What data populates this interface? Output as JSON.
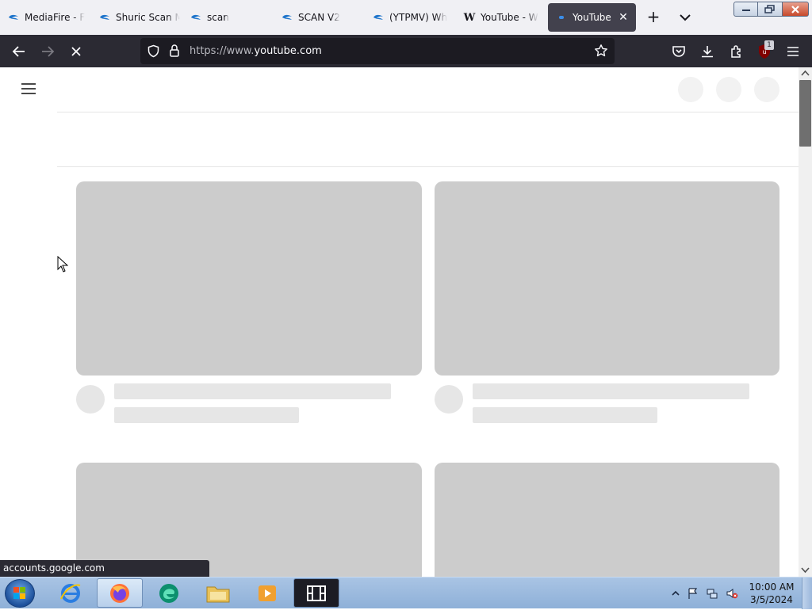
{
  "browser": {
    "tabs": [
      {
        "title": "MediaFire - F",
        "favicon": "mediafire-icon"
      },
      {
        "title": "Shuric Scan M",
        "favicon": "mediafire-icon"
      },
      {
        "title": "scan",
        "favicon": "mediafire-icon"
      },
      {
        "title": "SCAN V2",
        "favicon": "mediafire-icon"
      },
      {
        "title": "(YTPMV) Wh",
        "favicon": "mediafire-icon"
      },
      {
        "title": "YouTube - W",
        "favicon": "wikipedia-icon"
      },
      {
        "title": "YouTube",
        "favicon": "loading-dot-icon",
        "active": true
      }
    ],
    "url": {
      "scheme": "https://www.",
      "host": "youtube.com"
    },
    "extension_badge": "1",
    "status_link": "accounts.google.com"
  },
  "taskbar": {
    "apps": [
      "internet-explorer",
      "firefox",
      "edge",
      "file-explorer",
      "media-player",
      "video-app"
    ],
    "clock": {
      "time": "10:00 AM",
      "date": "3/5/2024"
    }
  },
  "colors": {
    "tab_strip": "#f0f0f4",
    "toolbar": "#2b2a33",
    "urlbar": "#1c1b22",
    "skeleton_thumb": "#cccccc",
    "skeleton_text": "#e6e6e6",
    "taskbar": "#a9c4e4"
  }
}
